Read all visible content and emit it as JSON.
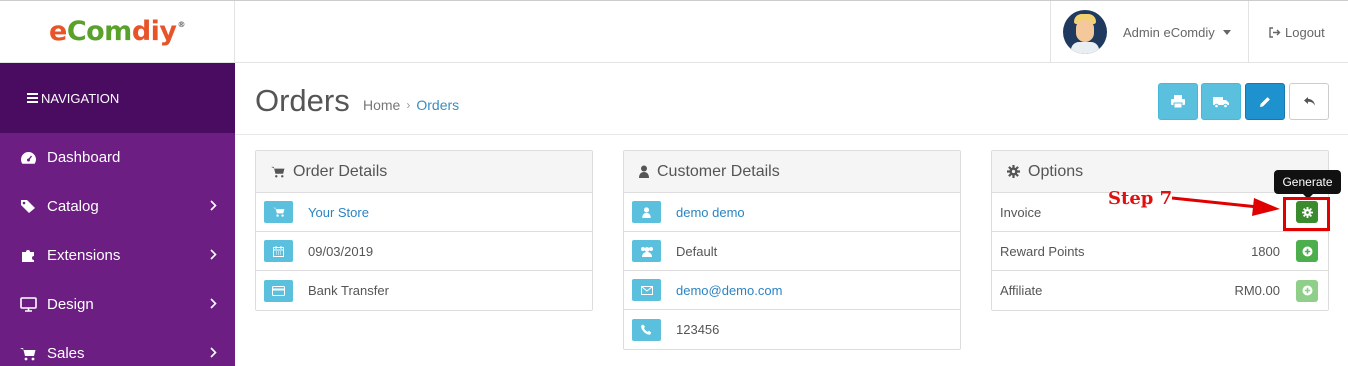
{
  "header": {
    "logo": {
      "e": "e",
      "com": "Com",
      "diy": "diy",
      "reg": "®"
    },
    "user_name": "Admin eComdiy",
    "logout_label": "Logout"
  },
  "sidebar": {
    "nav_title": "NAVIGATION",
    "items": [
      {
        "label": "Dashboard",
        "icon": "dashboard-icon",
        "has_children": false
      },
      {
        "label": "Catalog",
        "icon": "tag-icon",
        "has_children": true
      },
      {
        "label": "Extensions",
        "icon": "puzzle-icon",
        "has_children": true
      },
      {
        "label": "Design",
        "icon": "monitor-icon",
        "has_children": true
      },
      {
        "label": "Sales",
        "icon": "cart-icon",
        "has_children": true
      }
    ]
  },
  "page": {
    "title": "Orders",
    "breadcrumb": {
      "home": "Home",
      "separator": "›",
      "current": "Orders"
    },
    "toolbar": [
      "print-icon",
      "truck-icon",
      "pencil-icon",
      "reply-icon"
    ]
  },
  "order_details": {
    "title": "Order Details",
    "store": "Your Store",
    "date": "09/03/2019",
    "payment": "Bank Transfer"
  },
  "customer_details": {
    "title": "Customer Details",
    "name": "demo demo",
    "group": "Default",
    "email": "demo@demo.com",
    "phone": "123456"
  },
  "options": {
    "title": "Options",
    "invoice_label": "Invoice",
    "reward_label": "Reward Points",
    "reward_value": "1800",
    "affiliate_label": "Affiliate",
    "affiliate_value": "RM0.00"
  },
  "annotation": {
    "tooltip": "Generate",
    "step": "Step 7"
  },
  "colors": {
    "sidebar": "#6c1e83",
    "sidebar_header": "#4a0c60",
    "info": "#5bc0de",
    "primary": "#1e91cf",
    "success": "#4cae4c",
    "annotation_red": "#e00000"
  }
}
